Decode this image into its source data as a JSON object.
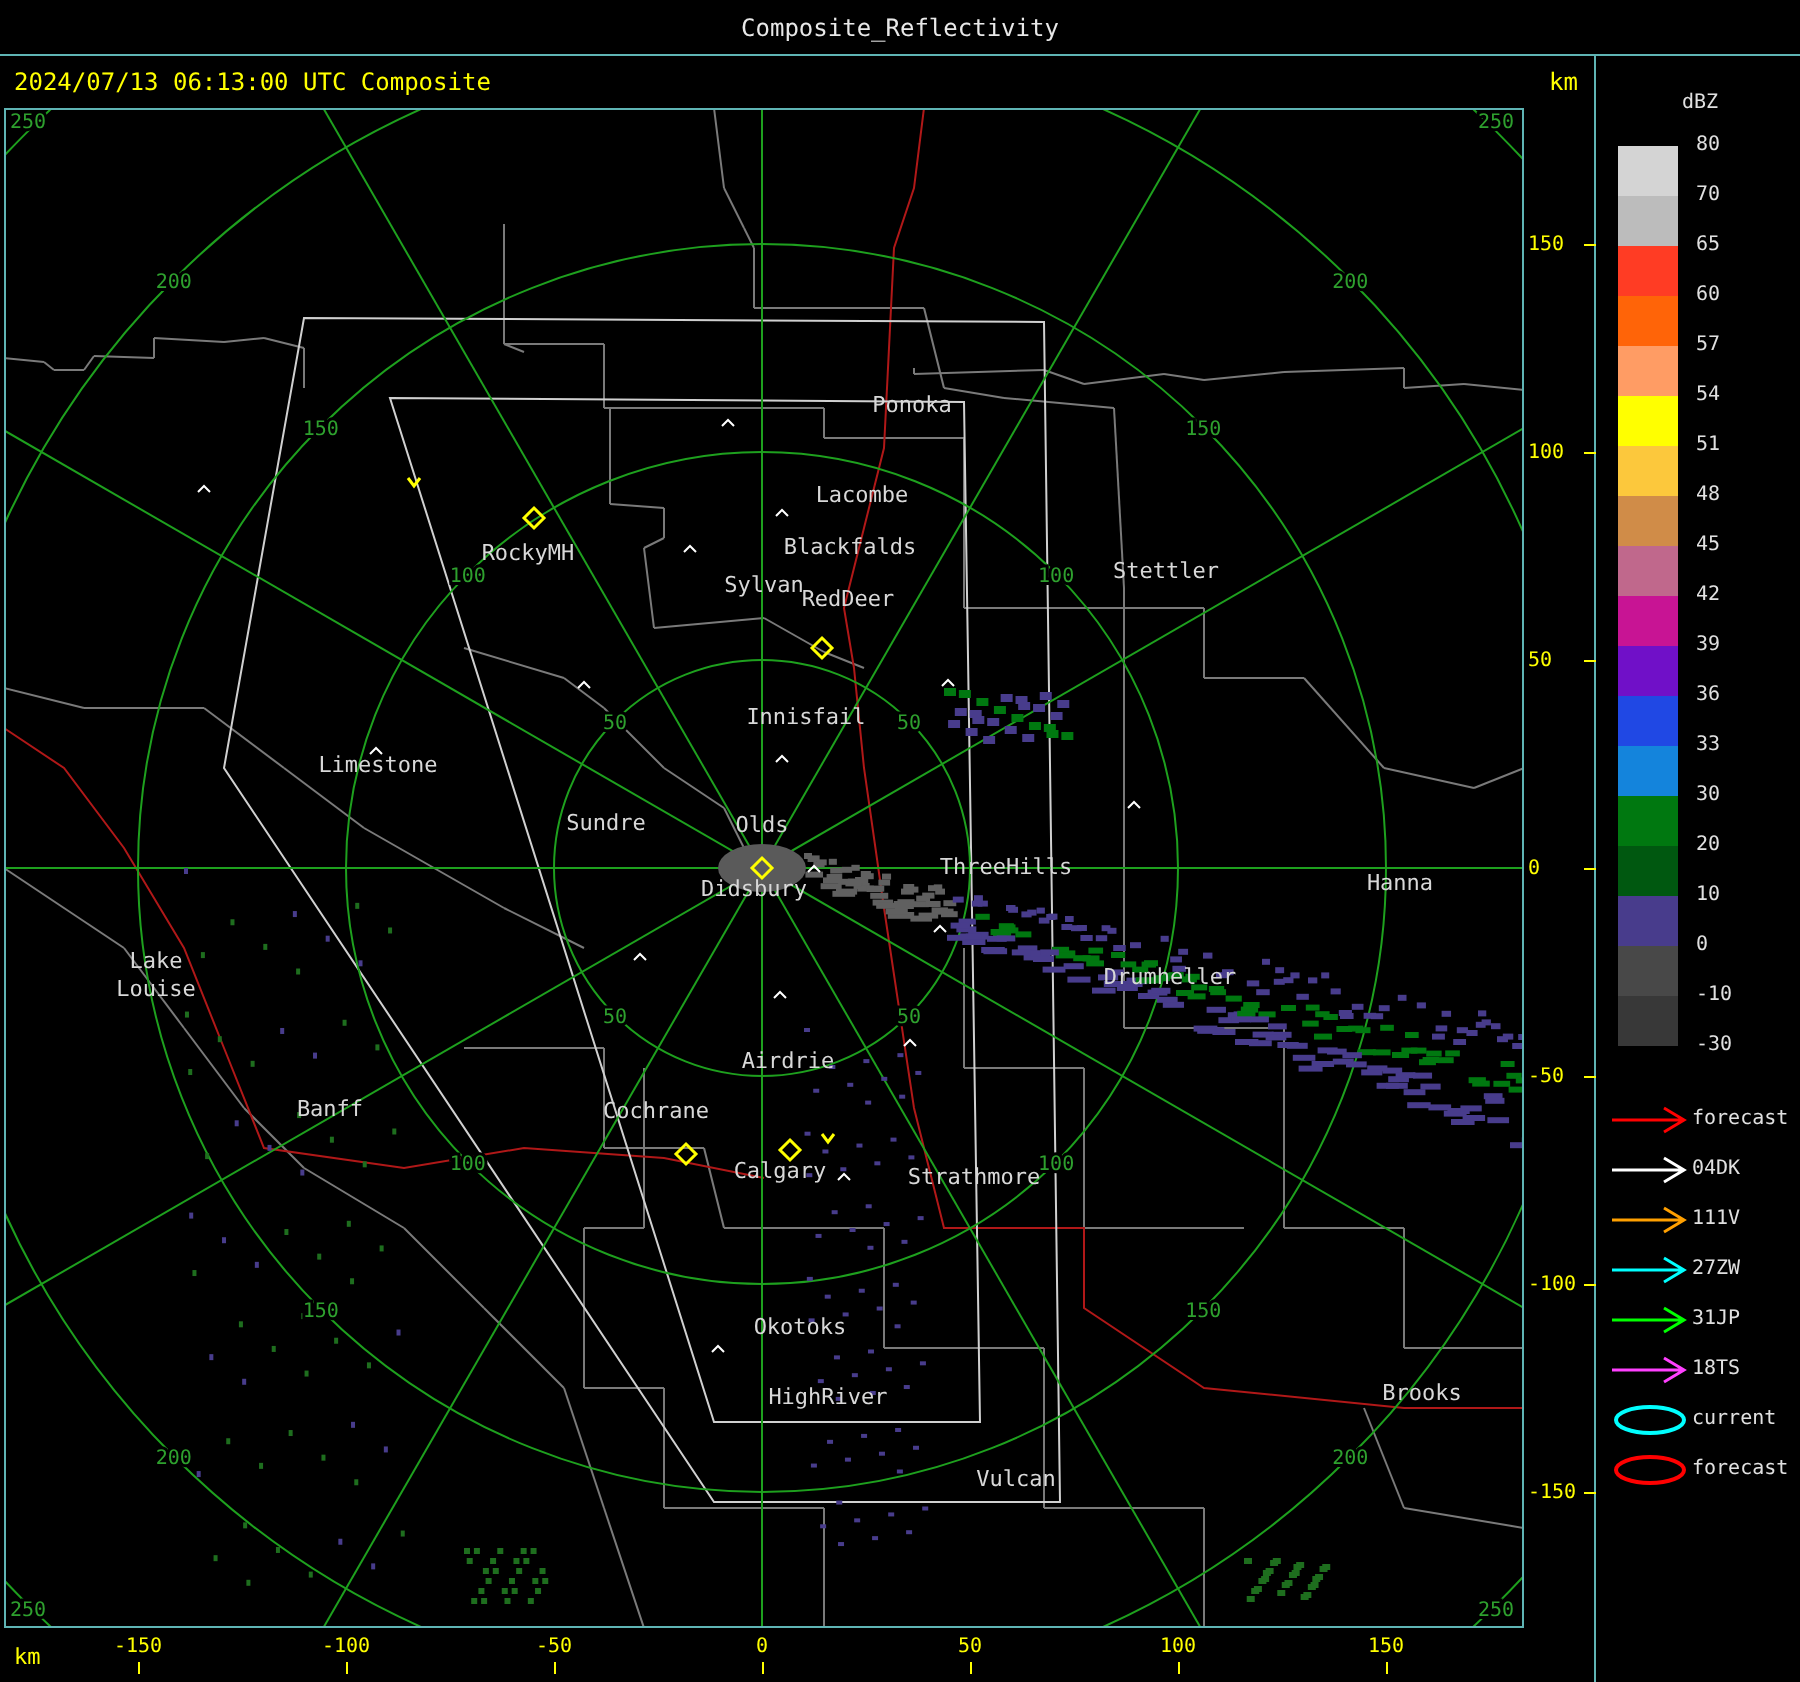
{
  "window": {
    "title": "Composite_Reflectivity"
  },
  "header": {
    "timestamp": "2024/07/13 06:13:00 UTC Composite",
    "y_unit": "km"
  },
  "map": {
    "range_rings": [
      {
        "labels": [
          "50",
          "50",
          "50",
          "50"
        ]
      },
      {
        "labels": [
          "100",
          "100",
          "100",
          "100"
        ]
      },
      {
        "labels": [
          "150",
          "150",
          "150",
          "150"
        ]
      },
      {
        "labels": [
          "200",
          "200",
          "200",
          "200"
        ]
      },
      {
        "labels": [
          "250",
          "250",
          "250",
          "250"
        ]
      }
    ],
    "places": [
      {
        "name": "Ponoka"
      },
      {
        "name": "Lacombe"
      },
      {
        "name": "Blackfalds"
      },
      {
        "name": "Sylvan"
      },
      {
        "name": "RedDeer"
      },
      {
        "name": "RockyMH"
      },
      {
        "name": "Stettler"
      },
      {
        "name": "Innisfail"
      },
      {
        "name": "Limestone"
      },
      {
        "name": "Sundre"
      },
      {
        "name": "Olds"
      },
      {
        "name": "Didsbury"
      },
      {
        "name": "ThreeHills"
      },
      {
        "name": "Hanna"
      },
      {
        "name": "Lake Louise"
      },
      {
        "name": "Drumheller"
      },
      {
        "name": "Airdrie"
      },
      {
        "name": "Banff"
      },
      {
        "name": "Cochrane"
      },
      {
        "name": "Calgary"
      },
      {
        "name": "Strathmore"
      },
      {
        "name": "Okotoks"
      },
      {
        "name": "HighRiver"
      },
      {
        "name": "Brooks"
      },
      {
        "name": "Vulcan"
      }
    ]
  },
  "y_axis": {
    "ticks": [
      "150",
      "100",
      "50",
      "0",
      "-50",
      "-100",
      "-150"
    ]
  },
  "x_axis": {
    "unit": "km",
    "ticks": [
      "-150",
      "-100",
      "-50",
      "0",
      "50",
      "100",
      "150"
    ]
  },
  "legend": {
    "title": "dBZ",
    "bins": [
      {
        "color": "#d4d4d4"
      },
      {
        "color": "#bcbcbc"
      },
      {
        "color": "#ff3c24"
      },
      {
        "color": "#ff6408"
      },
      {
        "color": "#ff9c64"
      },
      {
        "color": "#ffff00"
      },
      {
        "color": "#fcc83c"
      },
      {
        "color": "#d08c48"
      },
      {
        "color": "#c0688c"
      },
      {
        "color": "#c81494"
      },
      {
        "color": "#7010c8"
      },
      {
        "color": "#2048e4"
      },
      {
        "color": "#1484dc"
      },
      {
        "color": "#007810"
      },
      {
        "color": "#005810"
      },
      {
        "color": "#483c8c"
      },
      {
        "color": "#484848"
      },
      {
        "color": "#383838"
      }
    ],
    "labels": [
      "80",
      "70",
      "65",
      "60",
      "57",
      "54",
      "51",
      "48",
      "45",
      "42",
      "39",
      "36",
      "33",
      "30",
      "20",
      "10",
      "0",
      "-10",
      "-30"
    ],
    "tracks": [
      {
        "kind": "arrow",
        "color": "#ff0000",
        "label": "forecast"
      },
      {
        "kind": "arrow",
        "color": "#ffffff",
        "label": "04DK"
      },
      {
        "kind": "arrow",
        "color": "#ffa000",
        "label": "111V"
      },
      {
        "kind": "arrow",
        "color": "#00ffff",
        "label": "27ZW"
      },
      {
        "kind": "arrow",
        "color": "#00ff00",
        "label": "31JP"
      },
      {
        "kind": "arrow",
        "color": "#ff40ff",
        "label": "18TS"
      },
      {
        "kind": "ellipse",
        "color": "#00ffff",
        "label": "current"
      },
      {
        "kind": "ellipse",
        "color": "#ff0000",
        "label": "forecast"
      }
    ]
  }
}
